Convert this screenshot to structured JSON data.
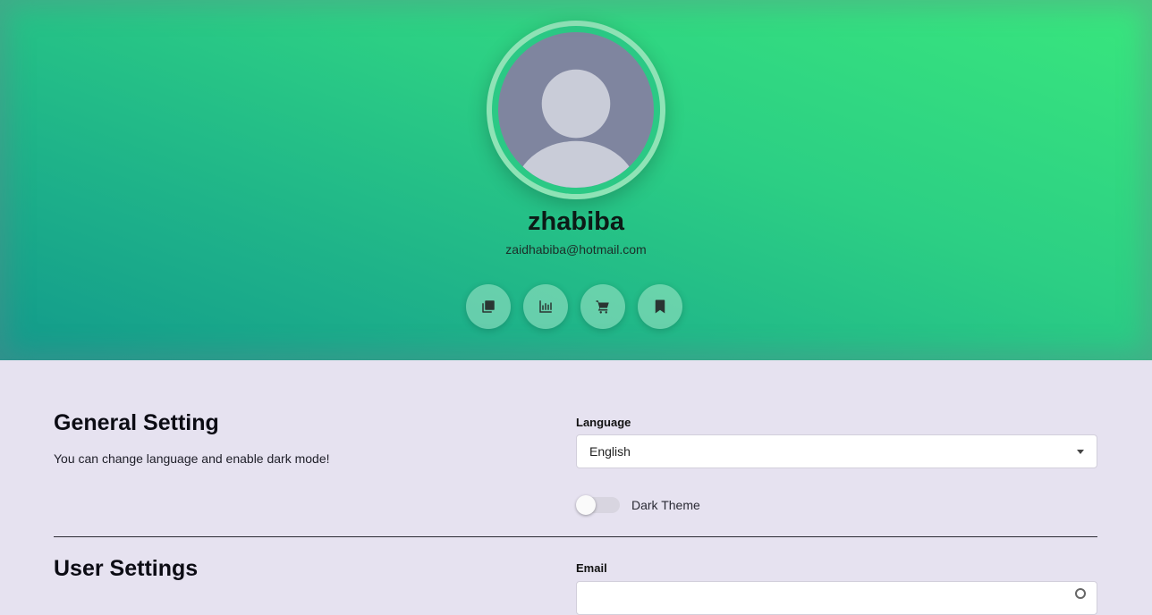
{
  "profile": {
    "username": "zhabiba",
    "email": "zaidhabiba@hotmail.com"
  },
  "actions": [
    {
      "icon": "collections-icon"
    },
    {
      "icon": "bar-chart-icon"
    },
    {
      "icon": "shopping-cart-icon"
    },
    {
      "icon": "bookmark-icon"
    }
  ],
  "general_settings": {
    "title": "General Setting",
    "description": "You can change language and enable dark mode!",
    "language_label": "Language",
    "language_value": "English",
    "dark_theme_label": "Dark Theme",
    "dark_theme_enabled": false
  },
  "user_settings": {
    "title": "User Settings",
    "email_label": "Email",
    "email_value": ""
  },
  "colors": {
    "hero_gradient_start": "#129a8c",
    "hero_gradient_end": "#39e77d",
    "page_background": "#e6e2f0",
    "avatar_ring": "#2bc985"
  }
}
